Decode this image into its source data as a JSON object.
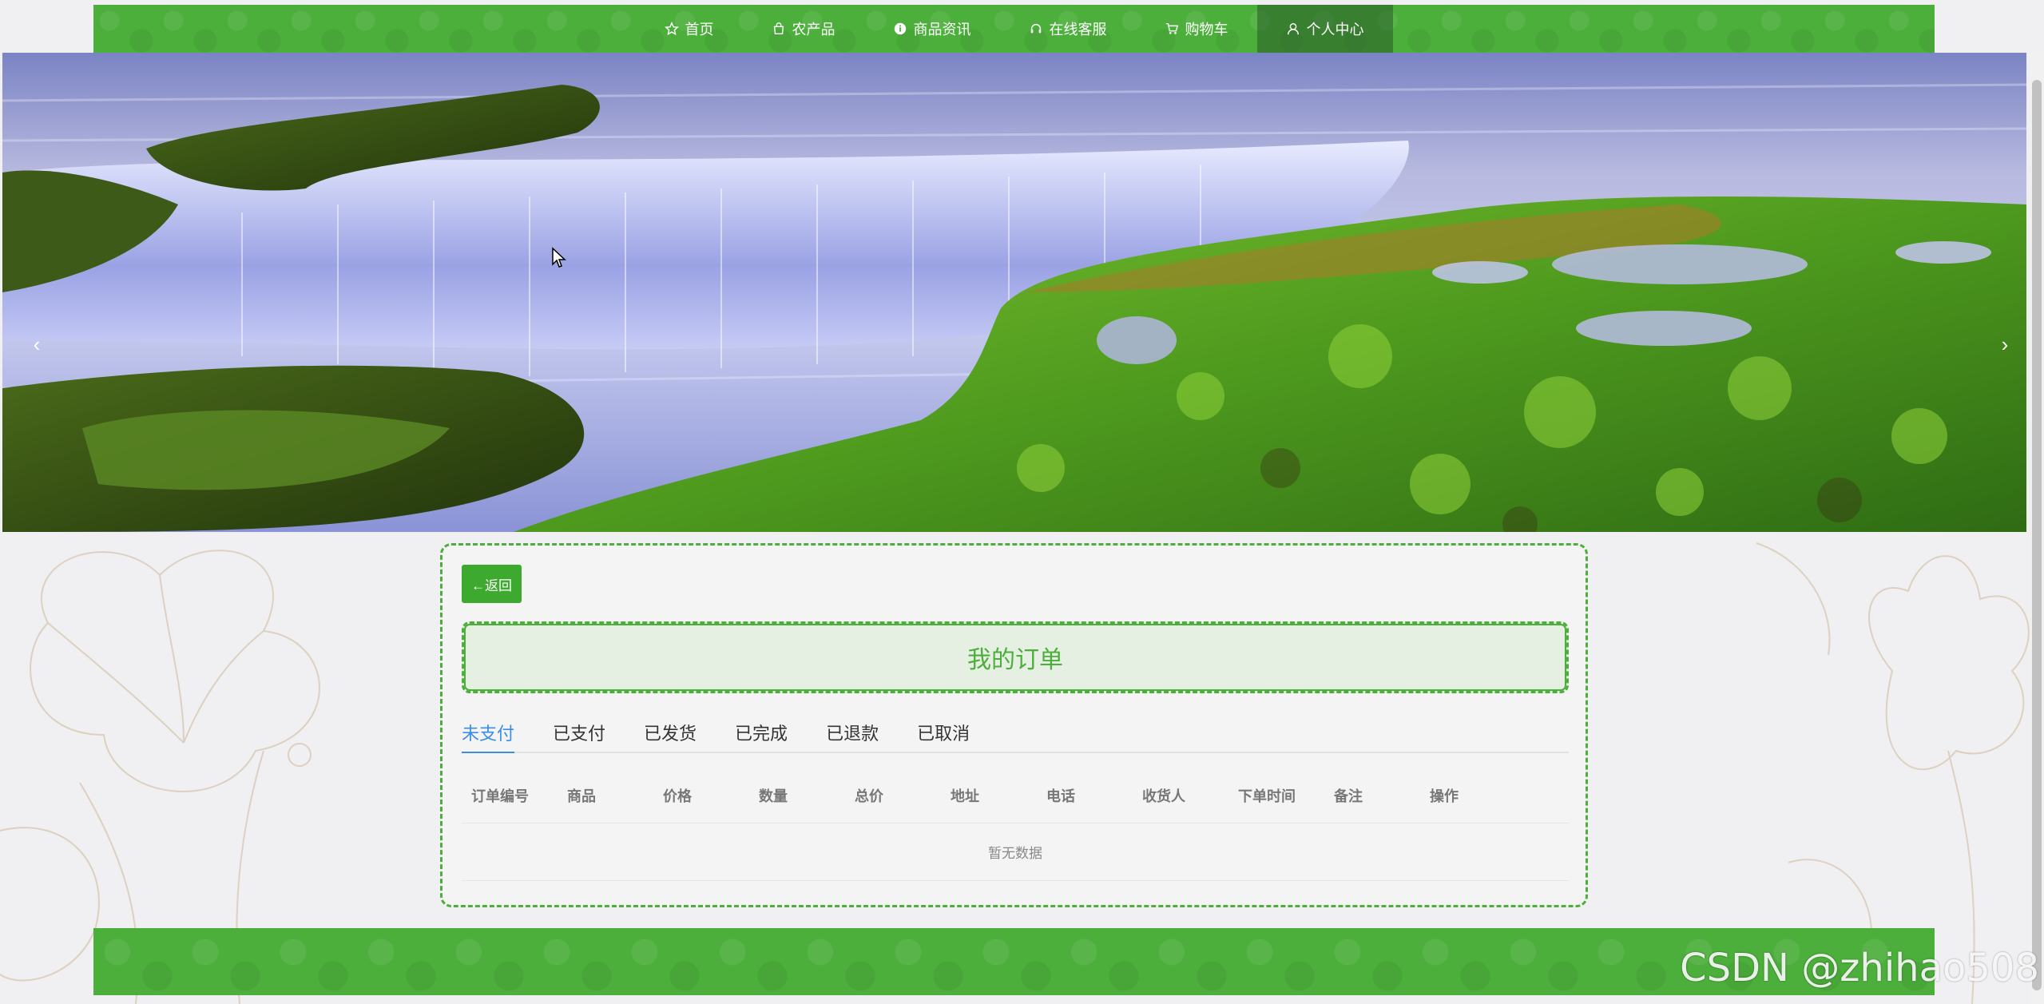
{
  "nav": {
    "items": [
      {
        "label": "首页",
        "icon": "star-icon"
      },
      {
        "label": "农产品",
        "icon": "bag-icon"
      },
      {
        "label": "商品资讯",
        "icon": "info-icon"
      },
      {
        "label": "在线客服",
        "icon": "headset-icon"
      },
      {
        "label": "购物车",
        "icon": "cart-icon"
      },
      {
        "label": "个人中心",
        "icon": "user-icon",
        "active": true
      }
    ]
  },
  "banner": {
    "prev_glyph": "‹",
    "next_glyph": "›",
    "slide_count": 3,
    "active_slide": 1
  },
  "orders": {
    "back_label": "←返回",
    "title": "我的订单",
    "tabs": [
      "未支付",
      "已支付",
      "已发货",
      "已完成",
      "已退款",
      "已取消"
    ],
    "active_tab": 0,
    "columns": [
      "订单编号",
      "商品",
      "价格",
      "数量",
      "总价",
      "地址",
      "电话",
      "收货人",
      "下单时间",
      "备注",
      "操作"
    ],
    "empty_text": "暂无数据"
  },
  "watermark": "CSDN @zhihao508",
  "colors": {
    "brand_green": "#4cae3b",
    "tab_active": "#3a8ee6"
  }
}
